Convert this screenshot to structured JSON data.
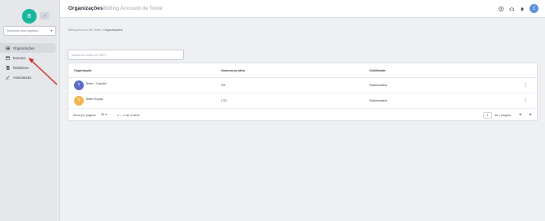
{
  "sidebar": {
    "logo_initial": "B",
    "collapse_icon": "«",
    "org_select_placeholder": "Selecione uma organiza...",
    "items": [
      {
        "label": "Organizações",
        "icon": "list-icon",
        "active": true
      },
      {
        "label": "Eventos",
        "icon": "calendar-icon",
        "active": false
      },
      {
        "label": "Relatórios",
        "icon": "document-icon",
        "active": false
      },
      {
        "label": "Assinaturas",
        "icon": "signature-icon",
        "active": false
      }
    ]
  },
  "header": {
    "title": "Organizações",
    "subtitle": "Billing Account de Teste",
    "avatar_initial": "C",
    "icons": [
      "help-icon",
      "cloud-icon",
      "bell-icon"
    ]
  },
  "breadcrumb": {
    "root": "Billing Account de Teste",
    "separator": "/",
    "current": "Organizações"
  },
  "search": {
    "placeholder": "Busca por nome ou CNPJ"
  },
  "table": {
    "headers": {
      "org": "Organização",
      "nature": "Natureza jurídica",
      "visibility": "Visibilidade"
    },
    "rows": [
      {
        "initial": "T",
        "name": "Teste - Camila",
        "sub": "",
        "nature": "SA",
        "visibility": "Stakeholders",
        "avatar_color": "#5a6bc9"
      },
      {
        "initial": "T",
        "name": "Teste Equity",
        "sub": "-",
        "nature": "LTD",
        "visibility": "Stakeholders",
        "avatar_color": "#f1b652"
      }
    ],
    "more_icon": "⋮"
  },
  "pagination": {
    "items_per_page_label": "Itens por página:",
    "items_per_page_value": "30 ▾",
    "range": "1 — 2 de 2 itens",
    "page": "1",
    "page_of": "de 1 página",
    "prev": "◂",
    "next": "▸"
  },
  "colors": {
    "accent": "#18b69b",
    "annotation_arrow": "#d62828"
  }
}
